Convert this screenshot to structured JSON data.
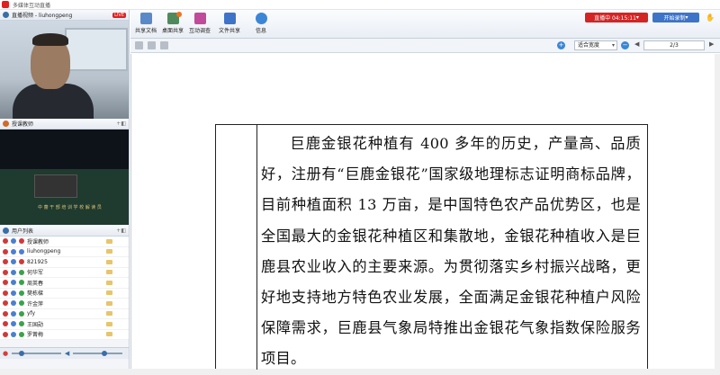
{
  "window": {
    "title": "多媒体互动直播"
  },
  "live_panel": {
    "title": "直播视频 - liuhongpeng",
    "badge": "LIVE"
  },
  "teacher_panel": {
    "title": "授课教师",
    "video_caption": "中 蕃 干 部 培 训 学 校    解 读 员"
  },
  "user_list": {
    "title": "用户列表",
    "users": [
      {
        "name": "授课教师",
        "color": "#d23838"
      },
      {
        "name": "liuhongpeng",
        "color": "#4a7fd1"
      },
      {
        "name": "821925",
        "color": "#d23838"
      },
      {
        "name": "何华军",
        "color": "#3aa34a"
      },
      {
        "name": "周英春",
        "color": "#3aa34a"
      },
      {
        "name": "樊栋樑",
        "color": "#3aa34a"
      },
      {
        "name": "许金萍",
        "color": "#3aa34a"
      },
      {
        "name": "yfy",
        "color": "#3aa34a"
      },
      {
        "name": "王国勋",
        "color": "#3aa34a"
      },
      {
        "name": "罗菁梅",
        "color": "#3aa34a"
      }
    ]
  },
  "toolbar": {
    "tools": [
      {
        "label": "共享文档",
        "icon": "document-icon",
        "color": "#5a89c9"
      },
      {
        "label": "桌面共享",
        "icon": "desktop-share-icon",
        "color": "#4f8a5e"
      },
      {
        "label": "互动调查",
        "icon": "bar-chart-icon",
        "color": "#c24a9a"
      },
      {
        "label": "文件共享",
        "icon": "file-share-icon",
        "color": "#3d74c8"
      },
      {
        "label": "信息",
        "icon": "info-icon",
        "color": "#3d86d6"
      }
    ],
    "recording": "直播中 04:15:11",
    "start_label": "开始录制"
  },
  "doc_toolbar": {
    "zoom_option": "适合宽度",
    "page": "2/3"
  },
  "document": {
    "paragraph": "巨鹿金银花种植有 400 多年的历史，产量高、品质好，注册有“巨鹿金银花”国家级地理标志证明商标品牌，目前种植面积 13 万亩，是中国特色农产品优势区，也是全国最大的金银花种植区和集散地，金银花种植收入是巨鹿县农业收入的主要来源。为贯彻落实乡村振兴战略，更好地支持地方特色农业发展，全面满足金银花种植户风险保障需求，巨鹿县气象局特推出金银花气象指数保险服务项目。"
  }
}
